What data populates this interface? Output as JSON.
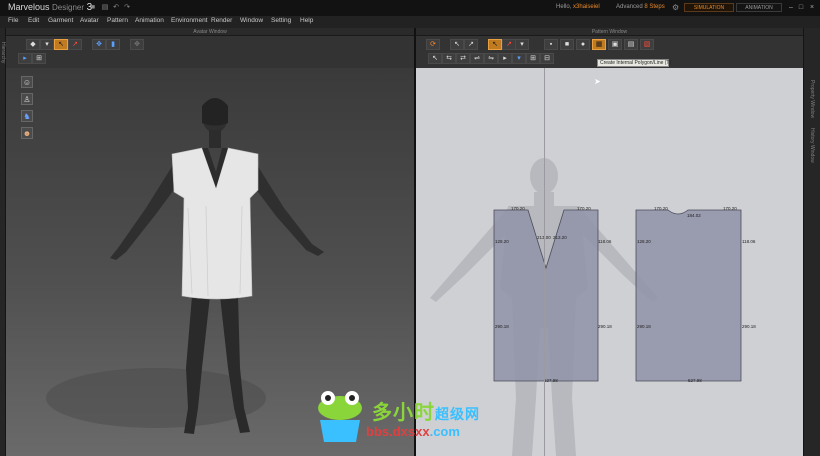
{
  "app": {
    "name": "Marvelous",
    "suffix": "Designer",
    "version": "3",
    "user_greeting": "Hello,",
    "user_name": "x3haiseiel",
    "mode_label": "Advanced",
    "mode_value": "8 Steps",
    "simulation_label": "SIMULATION",
    "animation_label": "ANIMATION"
  },
  "menu": [
    "File",
    "Edit",
    "Garment",
    "Avatar",
    "Pattern",
    "Animation",
    "Environment",
    "Render",
    "Window",
    "Setting",
    "Help"
  ],
  "avatar_window": {
    "title": "Avatar Window"
  },
  "pattern_window": {
    "title": "Pattern Window"
  },
  "left_tab": "Hierarchy",
  "right_tabs": [
    "Property Window",
    "History Window"
  ],
  "tooltip": "Create Internal Polygon/Line (T)",
  "colors": {
    "accent": "#e88a2a",
    "pattern_fill": "#8f92a8",
    "pattern_bg": "#cfd0d4"
  },
  "pattern_pieces": {
    "front": {
      "top_left": "170.20",
      "top_right": "170.20",
      "left_side_upper": "128.20",
      "right_side_upper": "118.06",
      "neck_left": "213.00",
      "neck_right": "213.20",
      "left_side_lower": "290.18",
      "right_side_lower": "290.18",
      "bottom": "527.98"
    },
    "back": {
      "top_left": "170.20",
      "top_right": "170.20",
      "neck": "184.02",
      "left_side_upper": "128.20",
      "right_side_upper": "118.06",
      "left_side_lower": "290.18",
      "right_side_lower": "290.18",
      "bottom": "527.98"
    }
  },
  "watermark": {
    "cn_main": "多小时",
    "cn_sub": "超级网",
    "url_main": "bbs.dxsxx",
    "url_tail": ".com"
  }
}
